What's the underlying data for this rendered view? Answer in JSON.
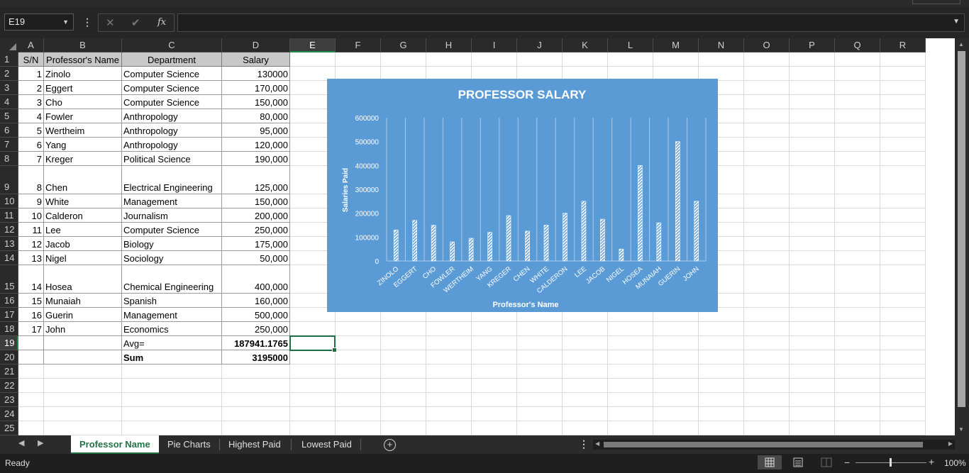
{
  "window": {
    "name_box": "E19",
    "formula": ""
  },
  "columns": [
    "A",
    "B",
    "C",
    "D",
    "E",
    "F",
    "G",
    "H",
    "I",
    "J",
    "K",
    "L",
    "M",
    "N",
    "O",
    "P",
    "Q",
    "R"
  ],
  "selected_column": "E",
  "selected_row": "19",
  "table_headers": [
    "S/N",
    "Professor's Name",
    "Department",
    "Salary"
  ],
  "rows": [
    {
      "row": "1"
    },
    {
      "row": "2",
      "sn": "1",
      "name": "Zinolo",
      "dept": "Computer Science",
      "salary": "130000"
    },
    {
      "row": "3",
      "sn": "2",
      "name": "Eggert",
      "dept": "Computer Science",
      "salary": "170,000"
    },
    {
      "row": "4",
      "sn": "3",
      "name": "Cho",
      "dept": "Computer Science",
      "salary": "150,000"
    },
    {
      "row": "5",
      "sn": "4",
      "name": "Fowler",
      "dept": "Anthropology",
      "salary": "80,000"
    },
    {
      "row": "6",
      "sn": "5",
      "name": "Wertheim",
      "dept": "Anthropology",
      "salary": "95,000"
    },
    {
      "row": "7",
      "sn": "6",
      "name": "Yang",
      "dept": "Anthropology",
      "salary": "120,000"
    },
    {
      "row": "8",
      "sn": "7",
      "name": "Kreger",
      "dept": "Political Science",
      "salary": "190,000"
    },
    {
      "row": "9",
      "sn": "8",
      "name": "Chen",
      "dept": "Electrical Engineering",
      "salary": "125,000"
    },
    {
      "row": "10",
      "sn": "9",
      "name": "White",
      "dept": "Management",
      "salary": "150,000"
    },
    {
      "row": "11",
      "sn": "10",
      "name": "Calderon",
      "dept": "Journalism",
      "salary": "200,000"
    },
    {
      "row": "12",
      "sn": "11",
      "name": "Lee",
      "dept": "Computer Science",
      "salary": "250,000"
    },
    {
      "row": "13",
      "sn": "12",
      "name": "Jacob",
      "dept": "Biology",
      "salary": "175,000"
    },
    {
      "row": "14",
      "sn": "13",
      "name": "Nigel",
      "dept": "Sociology",
      "salary": "50,000"
    },
    {
      "row": "15",
      "sn": "14",
      "name": "Hosea",
      "dept": "Chemical Engineering",
      "salary": "400,000"
    },
    {
      "row": "16",
      "sn": "15",
      "name": "Munaiah",
      "dept": "Spanish",
      "salary": "160,000"
    },
    {
      "row": "17",
      "sn": "16",
      "name": "Guerin",
      "dept": "Management",
      "salary": "500,000"
    },
    {
      "row": "18",
      "sn": "17",
      "name": "John",
      "dept": "Economics",
      "salary": "250,000"
    },
    {
      "row": "19",
      "label": "Avg=",
      "value": "187941.1765"
    },
    {
      "row": "20",
      "label": "Sum",
      "value": "3195000"
    },
    {
      "row": "21"
    },
    {
      "row": "22"
    },
    {
      "row": "23"
    },
    {
      "row": "24"
    },
    {
      "row": "25"
    }
  ],
  "chart_data": {
    "type": "bar",
    "title": "PROFESSOR SALARY",
    "xlabel": "Professor's Name",
    "ylabel": "Salaries Paid",
    "categories": [
      "ZINOLO",
      "EGGERT",
      "CHO",
      "FOWLER",
      "WERTHEIM",
      "YANG",
      "KREGER",
      "CHEN",
      "WHITE",
      "CALDERON",
      "LEE",
      "JACOB",
      "NIGEL",
      "HOSEA",
      "MUNAIAH",
      "GUERIN",
      "JOHN"
    ],
    "values": [
      130000,
      170000,
      150000,
      80000,
      95000,
      120000,
      190000,
      125000,
      150000,
      200000,
      250000,
      175000,
      50000,
      400000,
      160000,
      500000,
      250000
    ],
    "ylim": [
      0,
      600000
    ],
    "yticks": [
      "0",
      "100000",
      "200000",
      "300000",
      "400000",
      "500000",
      "600000"
    ],
    "grid": "vertical",
    "background": "#5b9bd5",
    "bar_fill": "white hatched"
  },
  "sheets": {
    "tabs": [
      "Professor Name",
      "Pie Charts",
      "Highest Paid",
      "Lowest Paid"
    ],
    "active": "Professor Name"
  },
  "status": {
    "text": "Ready",
    "zoom": "100%"
  },
  "icons": {
    "cancel": "x-icon",
    "enter": "check-icon",
    "function": "fx-icon",
    "add_sheet": "plus-circle-icon"
  }
}
